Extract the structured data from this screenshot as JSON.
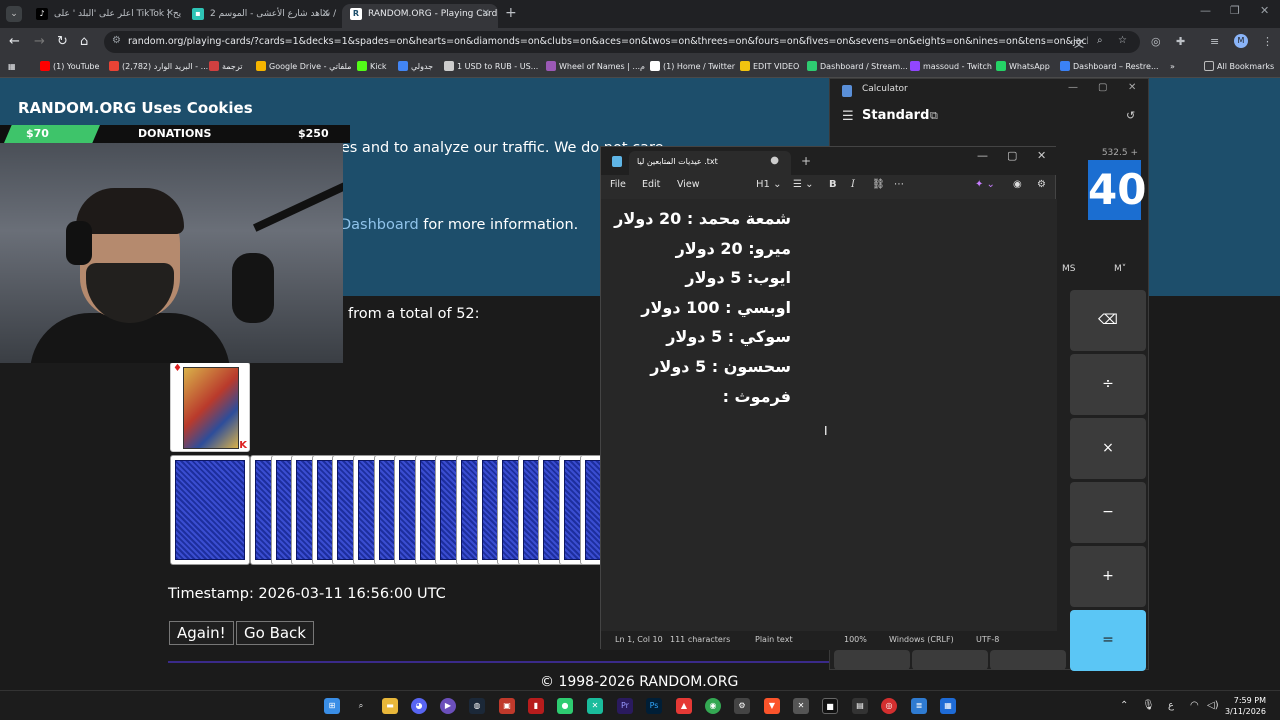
{
  "browser": {
    "tabs": [
      {
        "label": "اعلر على 'البلد ' على TikTok | يح..."
      },
      {
        "label": "شاهد شارع الأعشى - الموسم 2 /"
      },
      {
        "label": "RANDOM.ORG - Playing Card ..."
      }
    ],
    "url": "random.org/playing-cards/?cards=1&decks=1&spades=on&hearts=on&diamonds=on&clubs=on&aces=on&twos=on&threes=on&fours=on&fives=on&sevens=on&eights=on&nines=on&tens=on&jacks=on&que...",
    "profile_initial": "M",
    "bookmarks": [
      {
        "label": "(1) YouTube",
        "color": "#ff0000"
      },
      {
        "label": "(2,782) البريد الوارد - ...",
        "color": "#ea4335"
      },
      {
        "label": "ترجمة",
        "color": "#d04040"
      },
      {
        "label": "Google Drive - ملفاتي",
        "color": "#f4b400"
      },
      {
        "label": "Kick",
        "color": "#53fc18"
      },
      {
        "label": "جدولي",
        "color": "#4285f4"
      },
      {
        "label": "1 USD to RUB - US...",
        "color": "#cccccc"
      },
      {
        "label": "Wheel of Names | ...م",
        "color": "#9b59b6"
      },
      {
        "label": "(1) Home / Twitter",
        "color": "#ffffff"
      },
      {
        "label": "EDIT VIDEO",
        "color": "#f1c40f"
      },
      {
        "label": "Dashboard / Stream...",
        "color": "#2ecc71"
      },
      {
        "label": "massoud - Twitch",
        "color": "#9146ff"
      },
      {
        "label": "WhatsApp",
        "color": "#25d366"
      },
      {
        "label": "Dashboard – Restre...",
        "color": "#3b82f6"
      }
    ],
    "all_bookmarks": "All Bookmarks"
  },
  "page": {
    "cookie_title": "RANDOM.ORG Uses Cookies",
    "cookie_text": "We use cookies to remember your preferences and to analyze our traffic. We do not care",
    "cookie_link": "Dashboard",
    "cookie_more": " for more information.",
    "total_text": "from a total of 52:",
    "card_rank": "K",
    "timestamp": "Timestamp: 2026-03-11 16:56:00 UTC",
    "again_button": "Again!",
    "goback_button": "Go Back",
    "copyright": "© 1998-2026 RANDOM.ORG"
  },
  "donation": {
    "current": "$70",
    "label": "DONATIONS",
    "goal": "$250",
    "progress": 0.28
  },
  "calculator": {
    "title": "Calculator",
    "mode": "Standard",
    "expression": "532.5 +",
    "display": "40",
    "memory_buttons": [
      "MS",
      "M˅"
    ],
    "keys": [
      "⌫",
      "÷",
      "×",
      "−",
      "+",
      "="
    ]
  },
  "notepad": {
    "tab_title": "عيديات المتابعين ليا .txt",
    "menu": [
      "File",
      "Edit",
      "View"
    ],
    "heading": "H1",
    "lines": [
      "شمعة محمد : 20 دولار",
      "ميرو: 20 دولار",
      "ايوب: 5 دولار",
      "اوبسي : 100 دولار",
      "سوكي : 5 دولار",
      "سحسون : 5 دولار",
      "فرموث :"
    ],
    "status": {
      "position": "Ln 1, Col 10",
      "characters": "111 characters",
      "format": "Plain text",
      "zoom": "100%",
      "line_ending": "Windows (CRLF)",
      "encoding": "UTF-8"
    }
  },
  "taskbar": {
    "lang": "ع",
    "time": "7:59 PM",
    "date": "3/11/2026"
  }
}
